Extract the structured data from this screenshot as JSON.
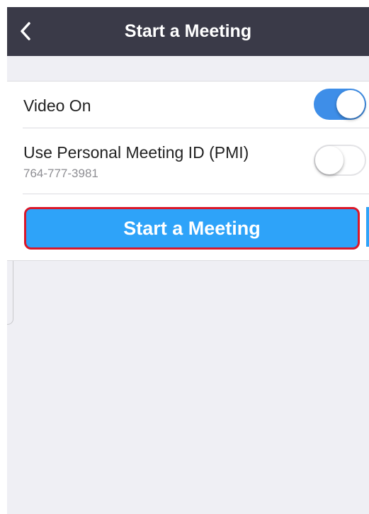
{
  "nav": {
    "title": "Start a Meeting",
    "back_icon": "chevron-left-icon"
  },
  "settings": {
    "video": {
      "label": "Video On",
      "enabled": true
    },
    "pmi": {
      "label": "Use Personal Meeting ID (PMI)",
      "meeting_id": "764-777-3981",
      "enabled": false
    }
  },
  "start_button": {
    "label": "Start a Meeting"
  },
  "colors": {
    "nav_bar": "#3a3a48",
    "toggle_on": "#3e8ee8",
    "start_button": "#2ea3f9",
    "highlight_border": "#d9182a",
    "background": "#efeff4"
  }
}
